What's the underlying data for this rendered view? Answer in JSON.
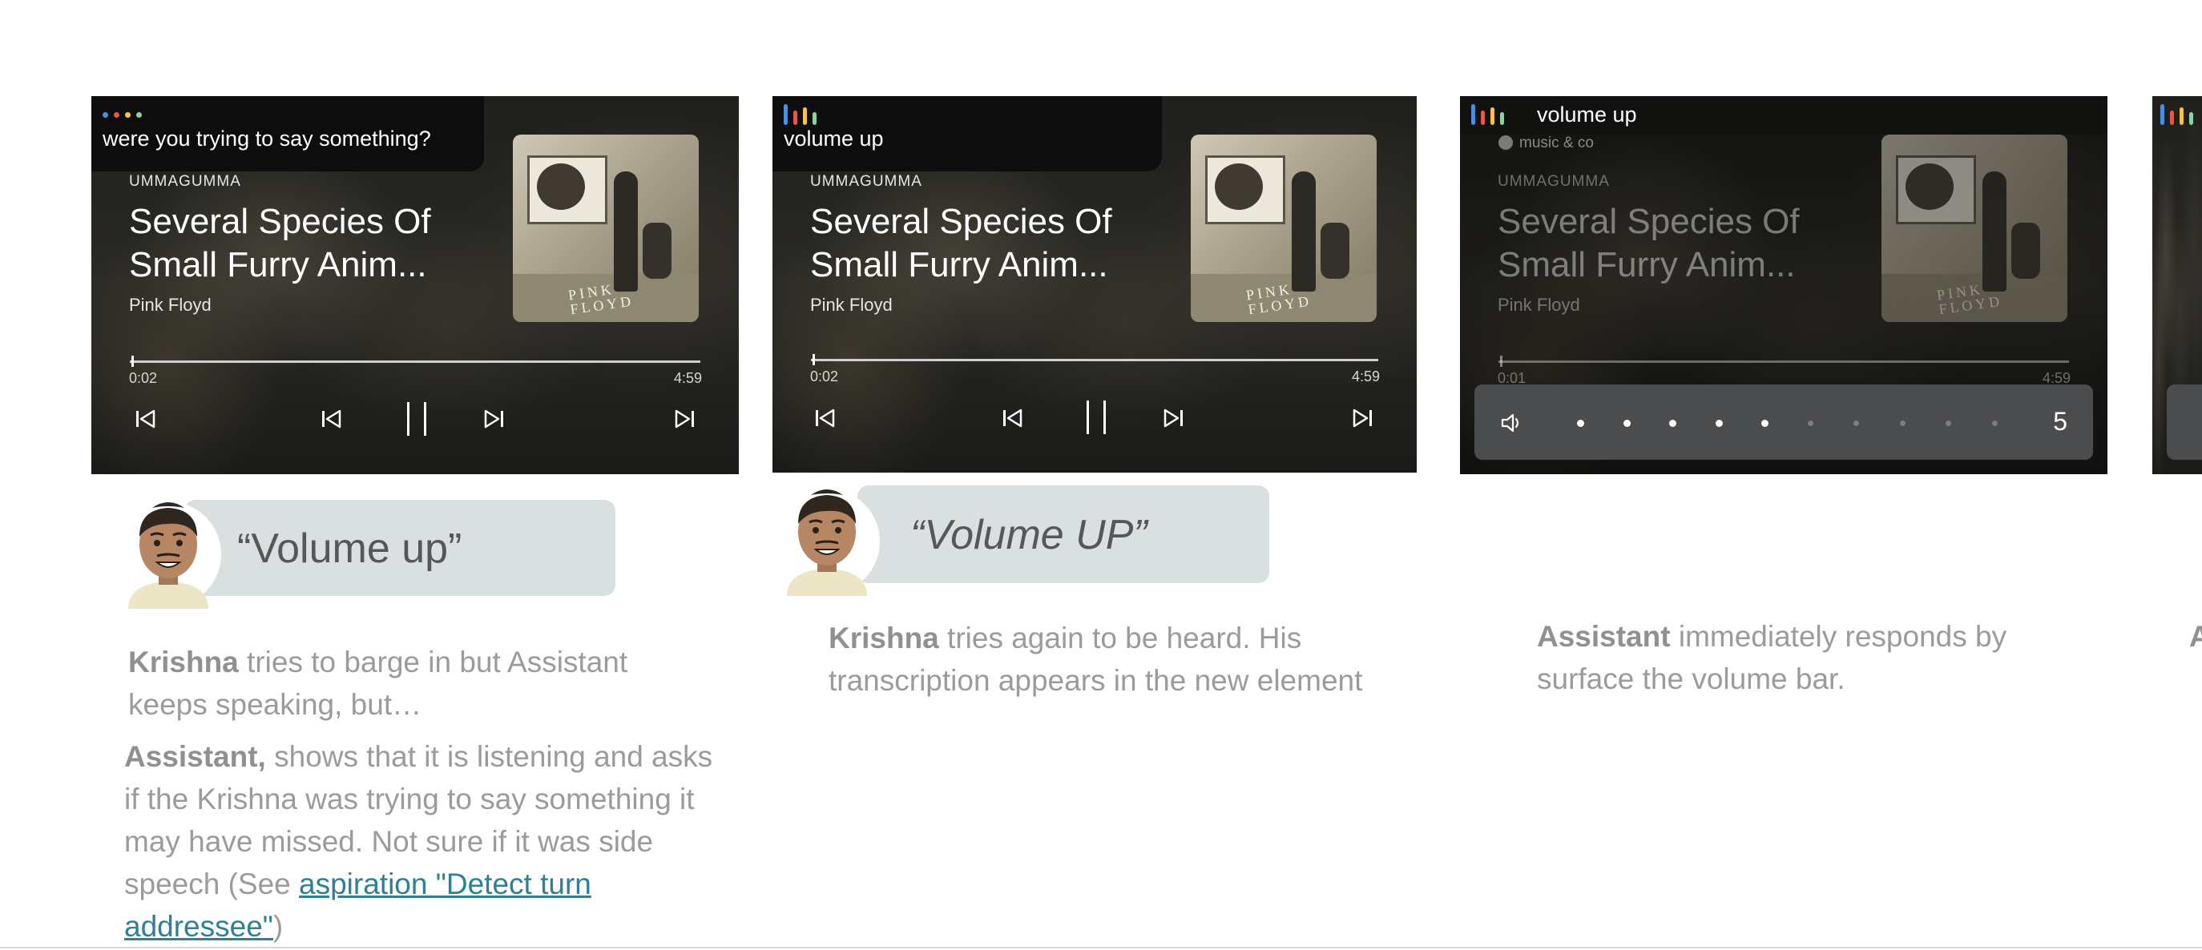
{
  "colors": {
    "assistant_blue": "#4a90e2",
    "assistant_red": "#e05a4a",
    "assistant_yellow": "#f3c34a",
    "assistant_green": "#8ad2a0",
    "link": "#2f7f95",
    "bubble_bg": "#dadfe0"
  },
  "frames": [
    {
      "toast": "were you trying to say something?",
      "album": "UMMAGUMMA",
      "title": "Several Species Of Small Furry Anim...",
      "artist": "Pink Floyd",
      "elapsed": "0:02",
      "duration": "4:59",
      "progress_fraction": 0.003
    },
    {
      "toast": "volume up",
      "album": "UMMAGUMMA",
      "title": "Several Species Of Small Furry Anim...",
      "artist": "Pink Floyd",
      "elapsed": "0:02",
      "duration": "4:59",
      "progress_fraction": 0.003
    },
    {
      "toast": "volume up",
      "source": "music & co",
      "album": "UMMAGUMMA",
      "title": "Several Species Of Small Furry Anim...",
      "artist": "Pink Floyd",
      "elapsed": "0:01",
      "duration": "4:59",
      "volume_level": "5",
      "volume_max": 10
    }
  ],
  "icons": {
    "controls": [
      "skip-previous-icon",
      "replay-icon",
      "pause-icon",
      "forward-icon",
      "skip-next-icon"
    ],
    "volume": "volume-icon",
    "source": "music-source-icon"
  },
  "quotes": [
    "“Volume up”",
    "“Volume UP”"
  ],
  "descriptions": {
    "d1": {
      "bold": "Krishna",
      "rest": " tries to barge in but Assistant keeps speaking, but…"
    },
    "d2": {
      "bold": "Assistant,",
      "rest": " shows that it is listening and asks if the Krishna was trying to say something it may have missed. Not sure if it was side speech (See ",
      "link": "aspiration \"Detect turn addressee\"",
      "tail": ")"
    },
    "d3": {
      "bold": "Krishna",
      "rest": " tries again to be heard. His transcription appears in the new element"
    },
    "d4": {
      "bold": "Assistant",
      "rest": " immediately responds by surface the volume bar."
    },
    "d5": {
      "bold": "A"
    }
  }
}
